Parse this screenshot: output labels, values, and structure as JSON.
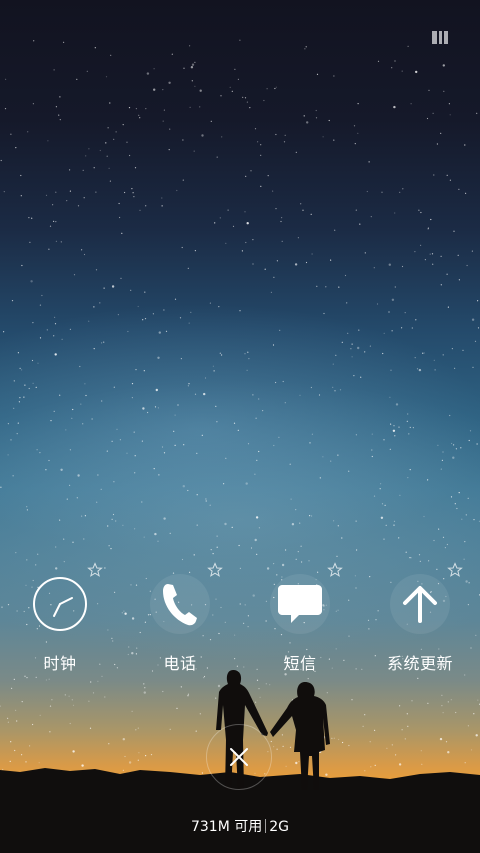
{
  "shortcuts": [
    {
      "label": "时钟",
      "icon": "clock-icon",
      "pinned": false
    },
    {
      "label": "电话",
      "icon": "phone-icon",
      "pinned": false
    },
    {
      "label": "短信",
      "icon": "message-icon",
      "pinned": false
    },
    {
      "label": "系统更新",
      "icon": "arrow-up-icon",
      "pinned": false
    }
  ],
  "memory": {
    "available": "731M 可用",
    "network": "2G"
  },
  "close_icon": "close-icon",
  "corner_icon": "clear-all-icon"
}
